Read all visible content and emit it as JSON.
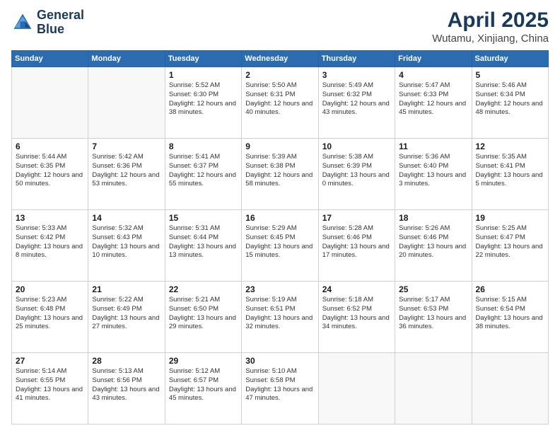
{
  "header": {
    "logo_line1": "General",
    "logo_line2": "Blue",
    "main_title": "April 2025",
    "sub_title": "Wutamu, Xinjiang, China"
  },
  "weekdays": [
    "Sunday",
    "Monday",
    "Tuesday",
    "Wednesday",
    "Thursday",
    "Friday",
    "Saturday"
  ],
  "weeks": [
    [
      {
        "day": null
      },
      {
        "day": null
      },
      {
        "day": "1",
        "sunrise": "Sunrise: 5:52 AM",
        "sunset": "Sunset: 6:30 PM",
        "daylight": "Daylight: 12 hours and 38 minutes."
      },
      {
        "day": "2",
        "sunrise": "Sunrise: 5:50 AM",
        "sunset": "Sunset: 6:31 PM",
        "daylight": "Daylight: 12 hours and 40 minutes."
      },
      {
        "day": "3",
        "sunrise": "Sunrise: 5:49 AM",
        "sunset": "Sunset: 6:32 PM",
        "daylight": "Daylight: 12 hours and 43 minutes."
      },
      {
        "day": "4",
        "sunrise": "Sunrise: 5:47 AM",
        "sunset": "Sunset: 6:33 PM",
        "daylight": "Daylight: 12 hours and 45 minutes."
      },
      {
        "day": "5",
        "sunrise": "Sunrise: 5:46 AM",
        "sunset": "Sunset: 6:34 PM",
        "daylight": "Daylight: 12 hours and 48 minutes."
      }
    ],
    [
      {
        "day": "6",
        "sunrise": "Sunrise: 5:44 AM",
        "sunset": "Sunset: 6:35 PM",
        "daylight": "Daylight: 12 hours and 50 minutes."
      },
      {
        "day": "7",
        "sunrise": "Sunrise: 5:42 AM",
        "sunset": "Sunset: 6:36 PM",
        "daylight": "Daylight: 12 hours and 53 minutes."
      },
      {
        "day": "8",
        "sunrise": "Sunrise: 5:41 AM",
        "sunset": "Sunset: 6:37 PM",
        "daylight": "Daylight: 12 hours and 55 minutes."
      },
      {
        "day": "9",
        "sunrise": "Sunrise: 5:39 AM",
        "sunset": "Sunset: 6:38 PM",
        "daylight": "Daylight: 12 hours and 58 minutes."
      },
      {
        "day": "10",
        "sunrise": "Sunrise: 5:38 AM",
        "sunset": "Sunset: 6:39 PM",
        "daylight": "Daylight: 13 hours and 0 minutes."
      },
      {
        "day": "11",
        "sunrise": "Sunrise: 5:36 AM",
        "sunset": "Sunset: 6:40 PM",
        "daylight": "Daylight: 13 hours and 3 minutes."
      },
      {
        "day": "12",
        "sunrise": "Sunrise: 5:35 AM",
        "sunset": "Sunset: 6:41 PM",
        "daylight": "Daylight: 13 hours and 5 minutes."
      }
    ],
    [
      {
        "day": "13",
        "sunrise": "Sunrise: 5:33 AM",
        "sunset": "Sunset: 6:42 PM",
        "daylight": "Daylight: 13 hours and 8 minutes."
      },
      {
        "day": "14",
        "sunrise": "Sunrise: 5:32 AM",
        "sunset": "Sunset: 6:43 PM",
        "daylight": "Daylight: 13 hours and 10 minutes."
      },
      {
        "day": "15",
        "sunrise": "Sunrise: 5:31 AM",
        "sunset": "Sunset: 6:44 PM",
        "daylight": "Daylight: 13 hours and 13 minutes."
      },
      {
        "day": "16",
        "sunrise": "Sunrise: 5:29 AM",
        "sunset": "Sunset: 6:45 PM",
        "daylight": "Daylight: 13 hours and 15 minutes."
      },
      {
        "day": "17",
        "sunrise": "Sunrise: 5:28 AM",
        "sunset": "Sunset: 6:46 PM",
        "daylight": "Daylight: 13 hours and 17 minutes."
      },
      {
        "day": "18",
        "sunrise": "Sunrise: 5:26 AM",
        "sunset": "Sunset: 6:46 PM",
        "daylight": "Daylight: 13 hours and 20 minutes."
      },
      {
        "day": "19",
        "sunrise": "Sunrise: 5:25 AM",
        "sunset": "Sunset: 6:47 PM",
        "daylight": "Daylight: 13 hours and 22 minutes."
      }
    ],
    [
      {
        "day": "20",
        "sunrise": "Sunrise: 5:23 AM",
        "sunset": "Sunset: 6:48 PM",
        "daylight": "Daylight: 13 hours and 25 minutes."
      },
      {
        "day": "21",
        "sunrise": "Sunrise: 5:22 AM",
        "sunset": "Sunset: 6:49 PM",
        "daylight": "Daylight: 13 hours and 27 minutes."
      },
      {
        "day": "22",
        "sunrise": "Sunrise: 5:21 AM",
        "sunset": "Sunset: 6:50 PM",
        "daylight": "Daylight: 13 hours and 29 minutes."
      },
      {
        "day": "23",
        "sunrise": "Sunrise: 5:19 AM",
        "sunset": "Sunset: 6:51 PM",
        "daylight": "Daylight: 13 hours and 32 minutes."
      },
      {
        "day": "24",
        "sunrise": "Sunrise: 5:18 AM",
        "sunset": "Sunset: 6:52 PM",
        "daylight": "Daylight: 13 hours and 34 minutes."
      },
      {
        "day": "25",
        "sunrise": "Sunrise: 5:17 AM",
        "sunset": "Sunset: 6:53 PM",
        "daylight": "Daylight: 13 hours and 36 minutes."
      },
      {
        "day": "26",
        "sunrise": "Sunrise: 5:15 AM",
        "sunset": "Sunset: 6:54 PM",
        "daylight": "Daylight: 13 hours and 38 minutes."
      }
    ],
    [
      {
        "day": "27",
        "sunrise": "Sunrise: 5:14 AM",
        "sunset": "Sunset: 6:55 PM",
        "daylight": "Daylight: 13 hours and 41 minutes."
      },
      {
        "day": "28",
        "sunrise": "Sunrise: 5:13 AM",
        "sunset": "Sunset: 6:56 PM",
        "daylight": "Daylight: 13 hours and 43 minutes."
      },
      {
        "day": "29",
        "sunrise": "Sunrise: 5:12 AM",
        "sunset": "Sunset: 6:57 PM",
        "daylight": "Daylight: 13 hours and 45 minutes."
      },
      {
        "day": "30",
        "sunrise": "Sunrise: 5:10 AM",
        "sunset": "Sunset: 6:58 PM",
        "daylight": "Daylight: 13 hours and 47 minutes."
      },
      {
        "day": null
      },
      {
        "day": null
      },
      {
        "day": null
      }
    ]
  ]
}
